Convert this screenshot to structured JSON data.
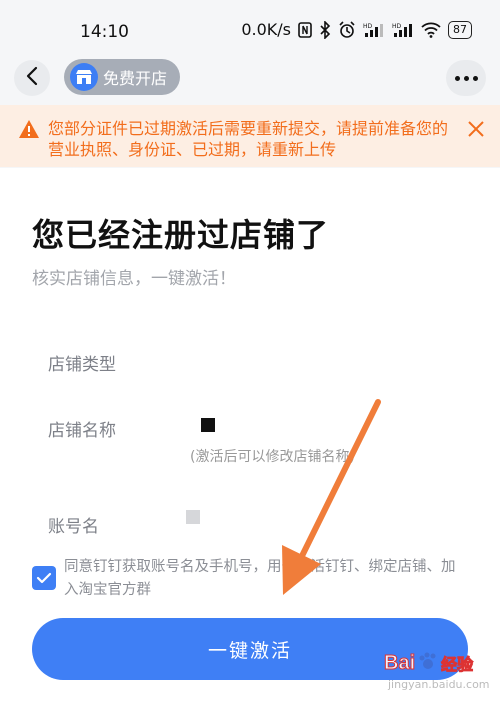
{
  "status_bar": {
    "time": "14:10",
    "network_speed": "0.0K/s",
    "battery": "87",
    "icons": [
      "nfc-icon",
      "bluetooth-icon",
      "alarm-icon",
      "signal-hd-icon",
      "signal-hd-icon",
      "wifi-icon",
      "battery-icon"
    ]
  },
  "nav": {
    "back_icon": "back-arrow-icon",
    "app_label": "免费开店",
    "app_icon": "shop-icon",
    "more_icon": "more-icon"
  },
  "notice": {
    "icon": "warning-icon",
    "text": "您部分证件已过期激活后需要重新提交，请提前准备您的营业执照、身份证、已过期，请重新上传",
    "close_icon": "close-icon",
    "color": "#f26d1c",
    "background": "#fdeee3"
  },
  "main": {
    "title": "您已经注册过店铺了",
    "subtitle": "核实店铺信息，一键激活！",
    "fields": {
      "type_label": "店铺类型",
      "name_label": "店铺名称",
      "name_hint": "(激活后可以修改店铺名称)",
      "account_label": "账号名"
    },
    "agreement_text": "同意钉钉获取账号名及手机号，用于激活钉钉、绑定店铺、加入淘宝官方群",
    "agreement_checked": true,
    "activate_label": "一键激活",
    "accent_color": "#3f7ff5"
  },
  "watermark": {
    "brand": "Bai",
    "brand_suffix": "经验",
    "sub": "jingyan.baidu.com"
  }
}
